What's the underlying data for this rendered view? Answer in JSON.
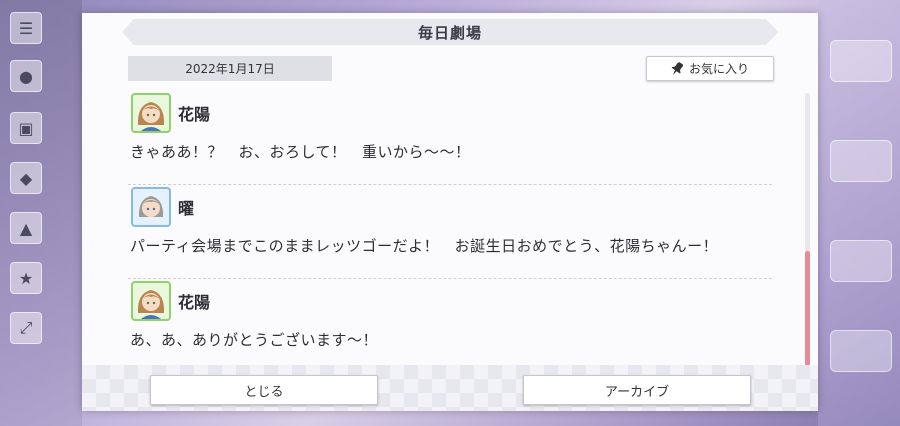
{
  "dialog": {
    "title": "毎日劇場",
    "date": "2022年1月17日",
    "favorite_label": "お気に入り",
    "entries": [
      {
        "speaker": "花陽",
        "text": "きゃああ！？　お、おろして！　重いから〜〜！",
        "avatar_color": "#8fd26a"
      },
      {
        "speaker": "曜",
        "text": "パーティ会場までこのままレッツゴーだよ！　お誕生日おめでとう、花陽ちゃんー！",
        "avatar_color": "#86b9e6"
      },
      {
        "speaker": "花陽",
        "text": "あ、あ、ありがとうございます〜！",
        "avatar_color": "#8fd26a"
      }
    ],
    "close_label": "とじる",
    "archive_label": "アーカイブ"
  },
  "colors": {
    "scroll_thumb": "#e88a93"
  }
}
